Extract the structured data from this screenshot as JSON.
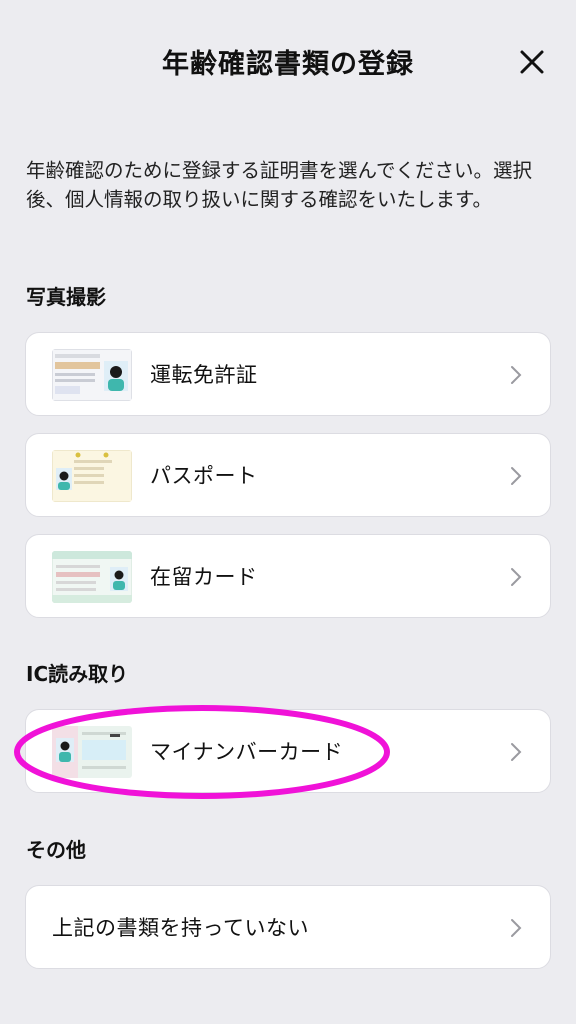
{
  "header": {
    "title": "年齢確認書類の登録",
    "close_icon": "close-icon"
  },
  "intro": "年齢確認のために登録する証明書を選んでください。選択後、個人情報の取り扱いに関する確認をいたします。",
  "sections": [
    {
      "label": "写真撮影",
      "items": [
        {
          "label": "運転免許証",
          "icon": "drivers-license-icon"
        },
        {
          "label": "パスポート",
          "icon": "passport-icon"
        },
        {
          "label": "在留カード",
          "icon": "residence-card-icon"
        }
      ]
    },
    {
      "label": "IC読み取り",
      "items": [
        {
          "label": "マイナンバーカード",
          "icon": "my-number-card-icon"
        }
      ]
    },
    {
      "label": "その他",
      "items": [
        {
          "label": "上記の書類を持っていない"
        }
      ]
    }
  ],
  "colors": {
    "background": "#ececf0",
    "highlight": "#f012d8",
    "chevron": "#9a9aa0"
  }
}
